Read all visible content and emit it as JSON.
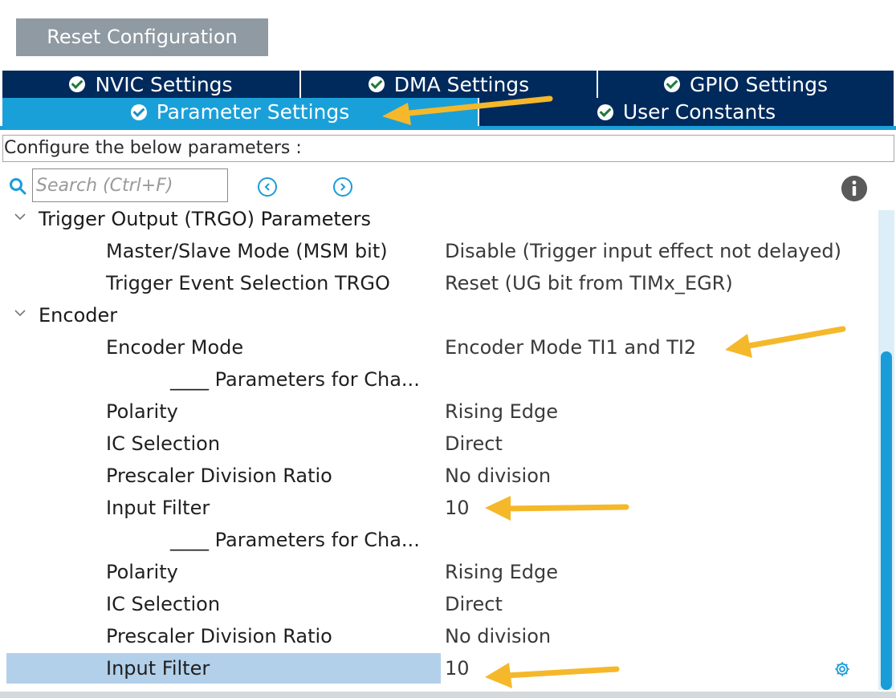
{
  "reset_button": "Reset Configuration",
  "tabs": {
    "row1": [
      {
        "label": "NVIC Settings"
      },
      {
        "label": "DMA Settings"
      },
      {
        "label": "GPIO Settings"
      }
    ],
    "row2": [
      {
        "label": "Parameter Settings",
        "active": true
      },
      {
        "label": "User Constants"
      }
    ]
  },
  "config_text": "Configure the below parameters :",
  "search": {
    "placeholder": "Search (Ctrl+F)"
  },
  "sections": {
    "trgo": {
      "title": "Trigger Output (TRGO) Parameters",
      "rows": [
        {
          "label": "Master/Slave Mode (MSM bit)",
          "value": "Disable (Trigger input effect not delayed)"
        },
        {
          "label": "Trigger Event Selection TRGO",
          "value": "Reset (UG bit from TIMx_EGR)"
        }
      ]
    },
    "encoder": {
      "title": "Encoder",
      "mode": {
        "label": "Encoder Mode",
        "value": "Encoder Mode TI1 and TI2"
      },
      "channel1": {
        "header": "____ Parameters for Cha...",
        "rows": [
          {
            "label": "Polarity",
            "value": "Rising Edge"
          },
          {
            "label": "IC Selection",
            "value": "Direct"
          },
          {
            "label": "Prescaler Division Ratio",
            "value": "No division"
          },
          {
            "label": "Input Filter",
            "value": "10"
          }
        ]
      },
      "channel2": {
        "header": "____ Parameters for Cha...",
        "rows": [
          {
            "label": "Polarity",
            "value": "Rising Edge"
          },
          {
            "label": "IC Selection",
            "value": "Direct"
          },
          {
            "label": "Prescaler Division Ratio",
            "value": "No division"
          },
          {
            "label": "Input Filter",
            "value": "10"
          }
        ]
      }
    }
  },
  "colors": {
    "tab_dark": "#002a5c",
    "tab_active": "#1aa0d9",
    "annotation_arrow": "#f5b82a",
    "selected_row": "#b3d0ea",
    "reset_button": "#8f9aa2"
  }
}
